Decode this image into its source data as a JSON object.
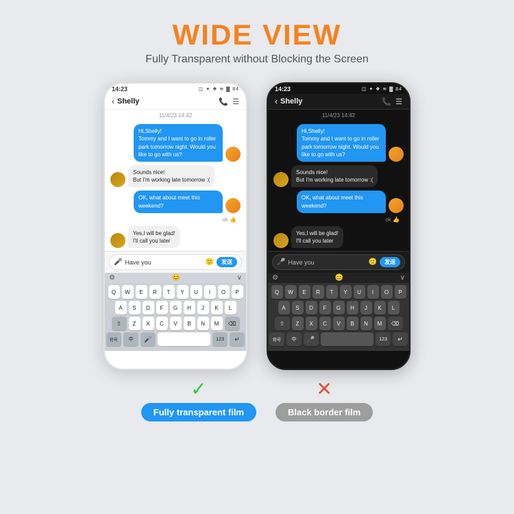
{
  "header": {
    "title": "WIDE VIEW",
    "subtitle": "Fully Transparent without Blocking the Screen"
  },
  "phones": {
    "left": {
      "status_time": "14:23",
      "status_icons": "◫ ✦ ❖ ≋ ▓ 84",
      "chat_name": "Shelly",
      "date_stamp": "11/4/23 14:42",
      "messages": [
        {
          "side": "right",
          "text": "Hi,Shelly!\nTommy and I want to go in roller park tomorrow night. Would you like to go with us?",
          "type": "blue"
        },
        {
          "side": "left",
          "text": "Sounds nice!\nBut I'm working late tomorrow :(",
          "type": "white"
        },
        {
          "side": "right",
          "text": "OK, what about meet this weekend?",
          "type": "blue"
        },
        {
          "side": "left",
          "text": "Yes,I will be glad!\nI'll call you later",
          "type": "white"
        }
      ],
      "ok_text": "ok",
      "input_placeholder": "Have you",
      "send_label": "发送"
    },
    "right": {
      "status_time": "14:23",
      "status_icons": "◫ ✦ ❖ ≋ ▓ 84",
      "chat_name": "Shelly",
      "date_stamp": "11/4/23 14:42",
      "messages": [
        {
          "side": "right",
          "text": "Hi,Shelly!\nTommy and I want to go in roller park tomorrow night. Would you like to go with us?",
          "type": "blue"
        },
        {
          "side": "left",
          "text": "Sounds nice!\nBut I'm working late tomorrow :(",
          "type": "white"
        },
        {
          "side": "right",
          "text": "OK, what about meet this weekend?",
          "type": "blue"
        },
        {
          "side": "left",
          "text": "Yes,I will be glad!\nI'll call you later",
          "type": "white"
        }
      ],
      "ok_text": "ok",
      "input_placeholder": "Have you",
      "send_label": "发送"
    }
  },
  "keyboard": {
    "rows": [
      [
        "Q",
        "W",
        "E",
        "R",
        "T",
        "Y",
        "U",
        "I",
        "O",
        "P"
      ],
      [
        "A",
        "S",
        "D",
        "F",
        "G",
        "H",
        "J",
        "K",
        "L"
      ],
      [
        "Z",
        "X",
        "C",
        "V",
        "B",
        "N",
        "M"
      ]
    ],
    "bottom": [
      "符号",
      "中",
      "⬤",
      "123",
      "↵"
    ]
  },
  "labels": {
    "left": {
      "check": "✓",
      "text": "Fully transparent film",
      "color": "blue"
    },
    "right": {
      "check": "✕",
      "text": "Black border film",
      "color": "gray"
    }
  }
}
